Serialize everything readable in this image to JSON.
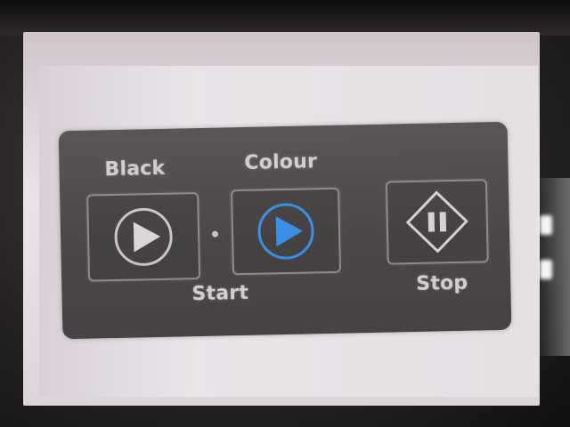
{
  "panel": {
    "black_label": "Black",
    "colour_label": "Colour",
    "start_label": "Start",
    "stop_label": "Stop"
  },
  "icons": {
    "black_start": "play-icon",
    "colour_start": "play-icon",
    "stop": "pause-diamond-icon"
  },
  "colors": {
    "panel": "#4b4749",
    "label": "#d3cdd1",
    "play_blue": "#3a8fe6",
    "play_gray": "#c9c5c8"
  }
}
